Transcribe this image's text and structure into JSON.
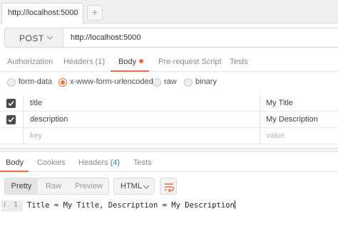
{
  "tabstrip": {
    "active_tab": "http://localhost:5000",
    "close_glyph": "×",
    "new_tab_glyph": "+"
  },
  "request": {
    "method": "POST",
    "url": "http://localhost:5000"
  },
  "request_tabs": [
    {
      "label": "Authorization",
      "active": false
    },
    {
      "label": "Headers (1)",
      "active": false
    },
    {
      "label": "Body",
      "active": true,
      "indicator": true
    },
    {
      "label": "Pre-request Script",
      "active": false
    },
    {
      "label": "Tests",
      "active": false
    }
  ],
  "body_types": [
    {
      "label": "form-data",
      "selected": false
    },
    {
      "label": "x-www-form-urlencoded",
      "selected": true
    },
    {
      "label": "raw",
      "selected": false
    },
    {
      "label": "binary",
      "selected": false
    }
  ],
  "params": [
    {
      "key": "title",
      "value": "My Title",
      "checked": true
    },
    {
      "key": "description",
      "value": "My Description",
      "checked": true
    }
  ],
  "params_placeholder": {
    "key": "key",
    "value": "value"
  },
  "response_tabs": {
    "body": "Body",
    "cookies": "Cookies",
    "headers": "Headers",
    "headers_count": "(4)",
    "tests": "Tests"
  },
  "view_modes": {
    "pretty": "Pretty",
    "raw": "Raw",
    "preview": "Preview",
    "active": "Pretty"
  },
  "language": "HTML",
  "editor": {
    "fold_marker": "i",
    "line_number": "1",
    "line": "Title = My Title, Description = My Description"
  },
  "colors": {
    "accent": "#f26b3a",
    "link_count": "#2f80c8"
  },
  "icons": [
    "close-icon",
    "plus-icon",
    "chevron-down-icon",
    "checkmark-icon",
    "wrap-lines-icon"
  ]
}
